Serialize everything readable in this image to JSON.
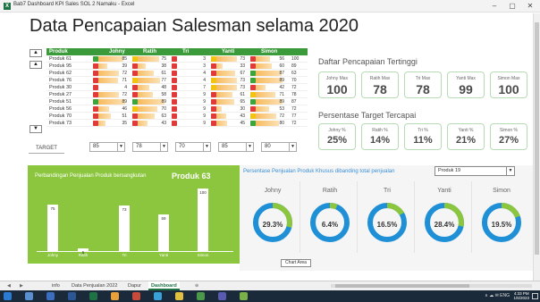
{
  "window": {
    "title": "Bab7 Dashboard KPI Sales SOL 2 Namaku - Excel",
    "minimize": "–",
    "restore": "▢",
    "close": "✕"
  },
  "dashboard": {
    "title": "Data Pencapaian Salesman selama 2020",
    "table": {
      "headers": [
        "Produk",
        "Johny",
        "Ratih",
        "Tri",
        "Yanti",
        "Simon"
      ],
      "rows": [
        {
          "product": "Produk 61",
          "johny": "85",
          "ratih": "75",
          "tri": "3",
          "yanti": "73",
          "simon": "56",
          "last": "100"
        },
        {
          "product": "Produk 95",
          "johny": "39",
          "ratih": "38",
          "tri": "3",
          "yanti": "33",
          "simon": "60",
          "last": "89"
        },
        {
          "product": "Produk 62",
          "johny": "72",
          "ratih": "61",
          "tri": "4",
          "yanti": "67",
          "simon": "87",
          "last": "63"
        },
        {
          "product": "Produk 76",
          "johny": "71",
          "ratih": "77",
          "tri": "4",
          "yanti": "73",
          "simon": "89",
          "last": "70"
        },
        {
          "product": "Produk 30",
          "johny": "4",
          "ratih": "48",
          "tri": "7",
          "yanti": "73",
          "simon": "42",
          "last": "72"
        },
        {
          "product": "Produk 27",
          "johny": "72",
          "ratih": "58",
          "tri": "9",
          "yanti": "61",
          "simon": "71",
          "last": "78"
        },
        {
          "product": "Produk 51",
          "johny": "89",
          "ratih": "89",
          "tri": "9",
          "yanti": "65",
          "simon": "89",
          "last": "87"
        },
        {
          "product": "Produk 56",
          "johny": "46",
          "ratih": "70",
          "tri": "9",
          "yanti": "30",
          "simon": "53",
          "last": "72"
        },
        {
          "product": "Produk 70",
          "johny": "51",
          "ratih": "63",
          "tri": "9",
          "yanti": "43",
          "simon": "72",
          "last": "77"
        },
        {
          "product": "Produk 73",
          "johny": "35",
          "ratih": "43",
          "tri": "9",
          "yanti": "45",
          "simon": "80",
          "last": "72"
        }
      ],
      "target_label": "TARGET",
      "targets": [
        "85",
        "78",
        "70",
        "85",
        "80"
      ]
    },
    "max_section": {
      "title": "Daftar Pencapaian Tertinggi",
      "cards": [
        {
          "label": "Johny Max",
          "value": "100"
        },
        {
          "label": "Ratih Max",
          "value": "78"
        },
        {
          "label": "Tri Max",
          "value": "78"
        },
        {
          "label": "Yanti Max",
          "value": "99"
        },
        {
          "label": "Simon Max",
          "value": "100"
        }
      ]
    },
    "pct_section": {
      "title": "Persentase Target Tercapai",
      "cards": [
        {
          "label": "Johny %",
          "value": "25%"
        },
        {
          "label": "Ratih %",
          "value": "14%"
        },
        {
          "label": "Tri %",
          "value": "11%"
        },
        {
          "label": "Yanti %",
          "value": "21%"
        },
        {
          "label": "Simon %",
          "value": "27%"
        }
      ]
    },
    "compare_chart": {
      "title": "Perbandingan Penjualan Produk bersangkutan",
      "product": "Produk 63"
    },
    "share_panel": {
      "title": "Persentase Penjualan Produk Khusus dibanding total penjualan",
      "selected_product": "Produk 19",
      "tooltip": "Chart Area",
      "donuts": [
        {
          "name": "Johny",
          "value": "29.3%",
          "pct": 29.3
        },
        {
          "name": "Ratih",
          "value": "6.4%",
          "pct": 6.4
        },
        {
          "name": "Tri",
          "value": "16.5%",
          "pct": 16.5
        },
        {
          "name": "Yanti",
          "value": "28.4%",
          "pct": 28.4
        },
        {
          "name": "Simon",
          "value": "19.5%",
          "pct": 19.5
        }
      ]
    }
  },
  "chart_data": {
    "type": "bar",
    "title": "Perbandingan Penjualan Produk bersangkutan",
    "subtitle": "Produk 63",
    "categories": [
      "Johny",
      "Ratih",
      "Tri",
      "Yanti",
      "Simon"
    ],
    "values": [
      75,
      5,
      73,
      59,
      100
    ],
    "ylim": [
      0,
      100
    ]
  },
  "sheet_tabs": {
    "nav_prev": "◀",
    "nav_next": "▶",
    "items": [
      "info",
      "Data Penjualan 2022",
      "Dapur",
      "Dashboard"
    ],
    "active": "Dashboard",
    "add": "⊕"
  },
  "taskbar": {
    "tray": "∧ ☁ ✉ ENG",
    "time": "4:33 PM",
    "date": "1/6/2023"
  },
  "colors": {
    "excel_green": "#1f7244",
    "header_green": "#3b9b3b",
    "chart_green": "#8cc63f",
    "donut_blue": "#1f8fd6",
    "donut_green": "#8cc63f"
  }
}
